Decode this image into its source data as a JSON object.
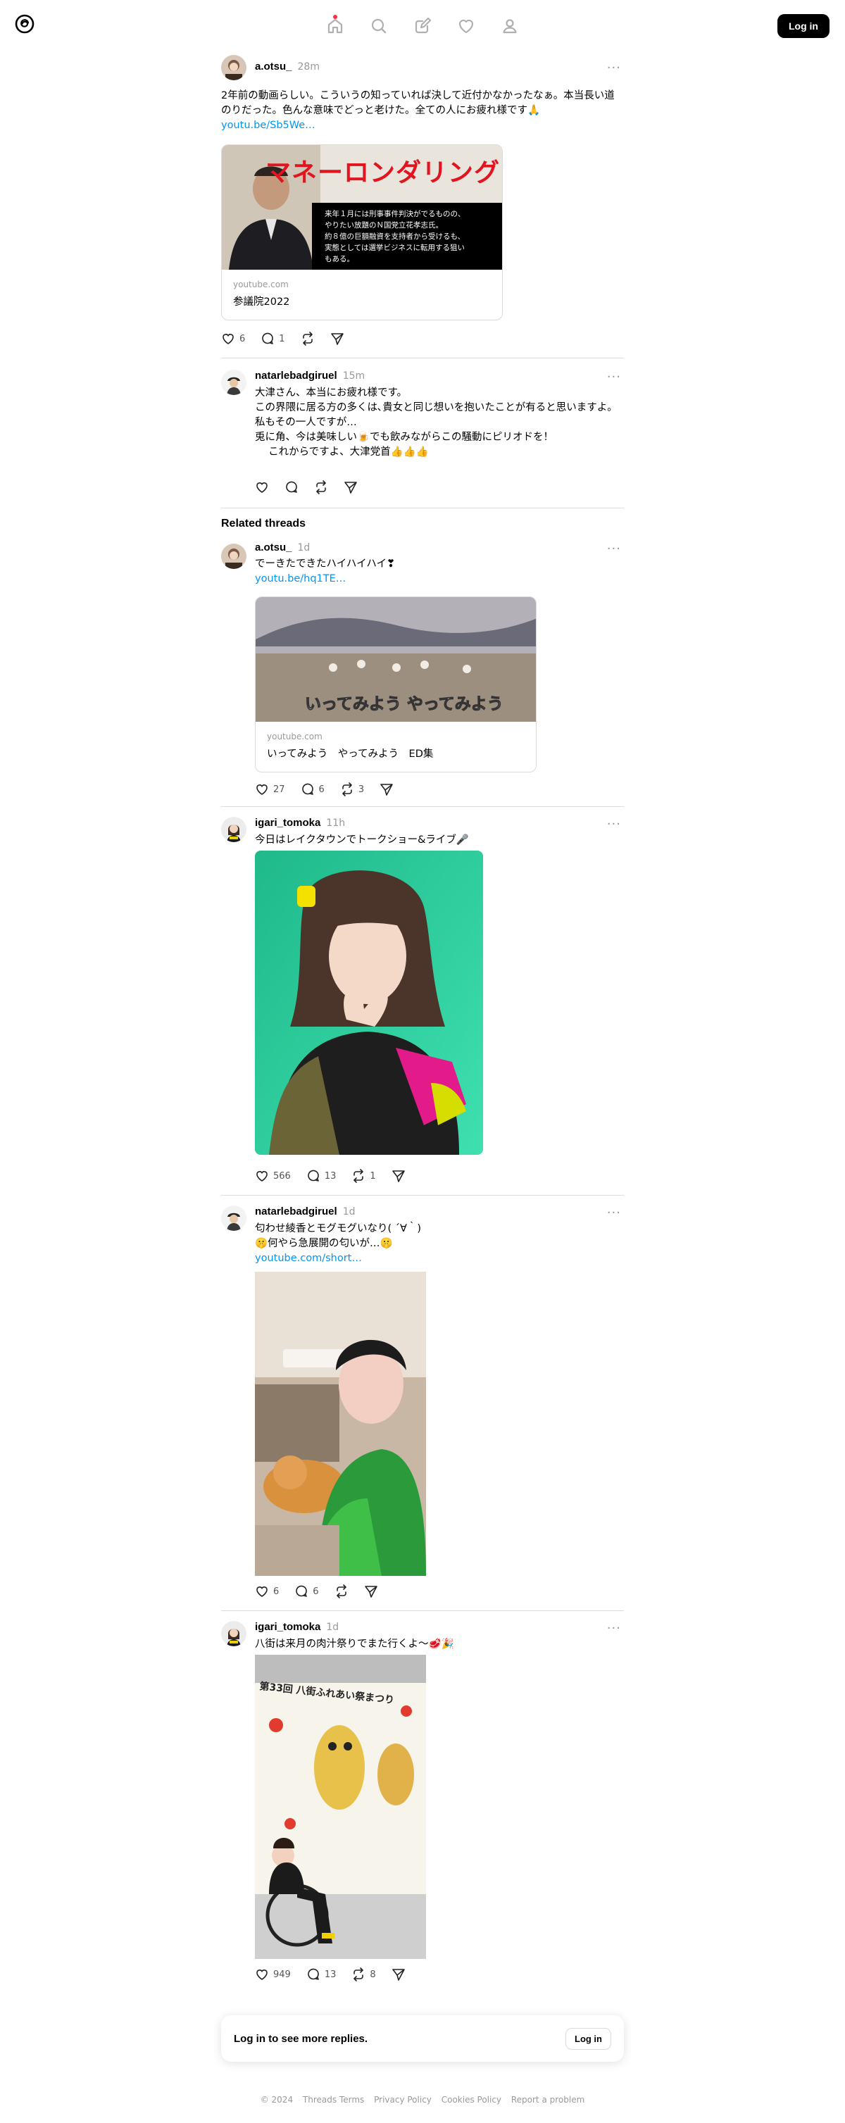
{
  "header": {
    "nav": [
      "home-icon",
      "search-icon",
      "compose-icon",
      "heart-icon",
      "profile-icon"
    ],
    "login_label": "Log in"
  },
  "main_post": {
    "username": "a.otsu_",
    "time": "28m",
    "text": "2年前の動画らしい。こういうの知っていれば決して近付かなかったなぁ。本当長い道のりだった。色んな意味でどっと老けた。全ての人にお疲れ様です🙏",
    "link": "youtu.be/Sb5We…",
    "card": {
      "thumb_title": "マネーロンダリング",
      "thumb_caption": "来年１月には刑事事件判決がでるものの、\nやりたい放題のＮ国党立花孝志氏。\n約８億の巨額融資を支持者から受けるも、\n実態としては選挙ビジネスに転用する狙い\nもある。",
      "domain": "youtube.com",
      "title": "参議院2022"
    },
    "likes": "6",
    "replies": "1"
  },
  "reply_post": {
    "username": "natarlebadgiruel",
    "time": "15m",
    "text": "大津さん、本当にお疲れ様です。\nこの界隈に居る方の多くは､貴女と同じ想いを抱いたことが有ると思いますよ。\n私もその一人ですが…\n兎に角、今は美味しい🍺でも飲みながらこの騒動にピリオドを！\n　 これからですよ、大津党首👍👍👍"
  },
  "related": {
    "title": "Related threads",
    "threads": [
      {
        "username": "a.otsu_",
        "time": "1d",
        "text": "でーきたできたハイハイハイ❣",
        "link": "youtu.be/hq1TE…",
        "card": {
          "thumb_title": "いってみよう やってみよう",
          "domain": "youtube.com",
          "title": "いってみよう　やってみよう　ED集"
        },
        "likes": "27",
        "replies": "6",
        "reposts": "3"
      },
      {
        "username": "igari_tomoka",
        "time": "11h",
        "text": "今日はレイクタウンでトークショー&ライブ🎤",
        "likes": "566",
        "replies": "13",
        "reposts": "1"
      },
      {
        "username": "natarlebadgiruel",
        "time": "1d",
        "text": "匂わせ綾香とモグモグいなり( ´∀｀)\n🤫何やら急展開の匂いが…🤫",
        "link": "youtube.com/short…",
        "likes": "6",
        "replies": "6"
      },
      {
        "username": "igari_tomoka",
        "time": "1d",
        "text": "八街は来月の肉汁祭りでまた行くよ〜🥩🎉",
        "banner_text": "第33回 八街ふれあい祭まつり",
        "likes": "949",
        "replies": "13",
        "reposts": "8"
      }
    ]
  },
  "cta": {
    "text": "Log in to see more replies.",
    "button": "Log in"
  },
  "footer": [
    "© 2024",
    "Threads Terms",
    "Privacy Policy",
    "Cookies Policy",
    "Report a problem"
  ]
}
